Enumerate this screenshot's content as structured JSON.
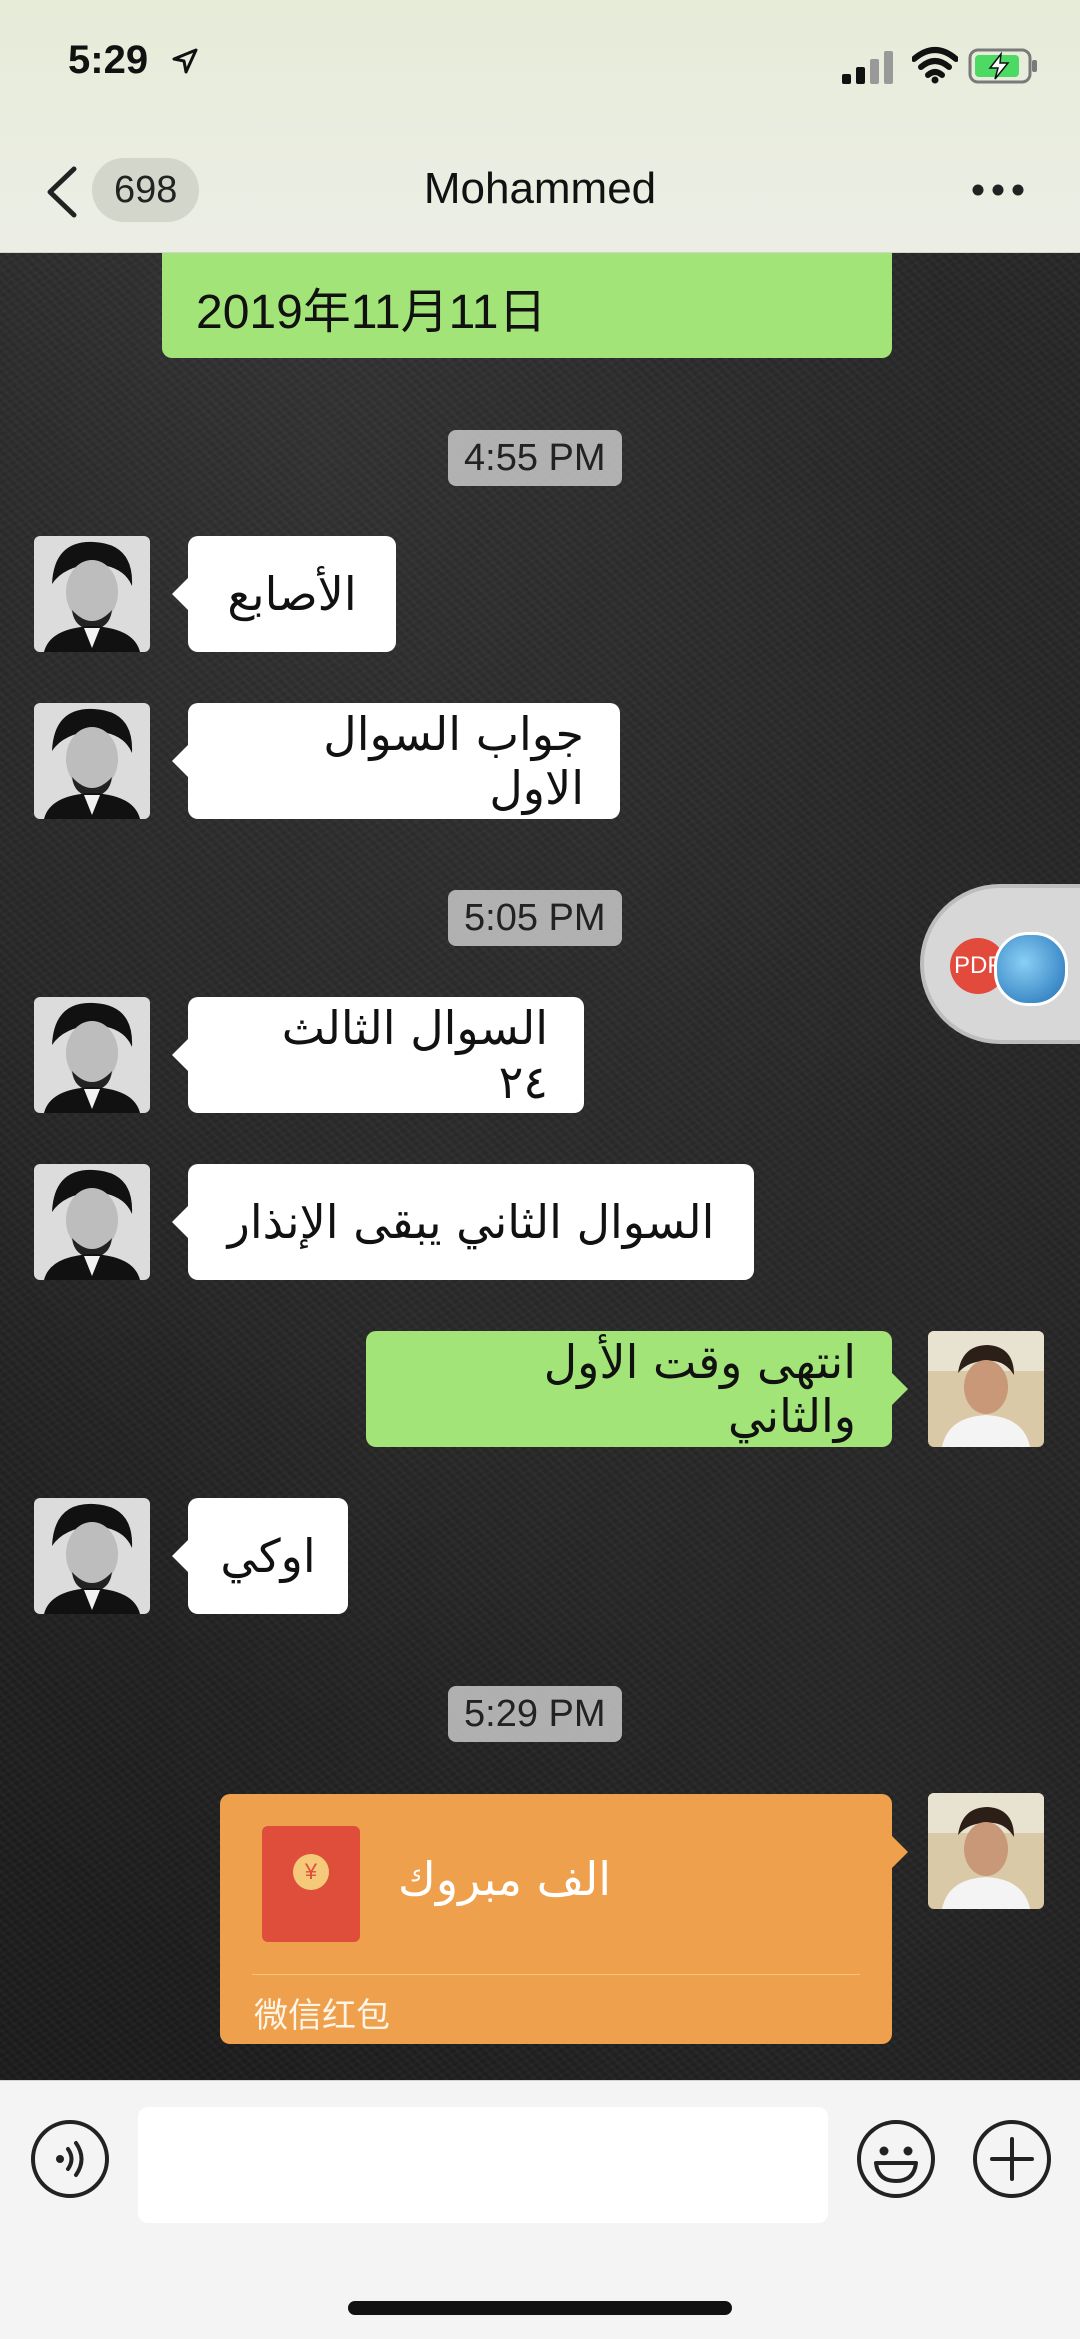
{
  "status_bar": {
    "time": "5:29"
  },
  "header": {
    "unread_count": "698",
    "title": "Mohammed"
  },
  "messages": {
    "top_partial_text": "2019年11月11日",
    "ts1": "4:55 PM",
    "m1": "الأصابع",
    "m2": "جواب السوال الاول",
    "ts2": "5:05 PM",
    "m3": "السوال الثالث ٢٤",
    "m4": "السوال الثاني يبقى الإنذار",
    "m5": "انتهى وقت الأول والثاني",
    "m6": "اوكي",
    "ts3": "5:29 PM"
  },
  "red_packet": {
    "title": "الف مبروك",
    "footer": "微信红包",
    "coin_symbol": "¥"
  },
  "floating_tab": {
    "pdf_label": "PDF"
  },
  "colors": {
    "sent": "#a3e479",
    "received": "#ffffff",
    "red_packet": "#efa04c"
  }
}
